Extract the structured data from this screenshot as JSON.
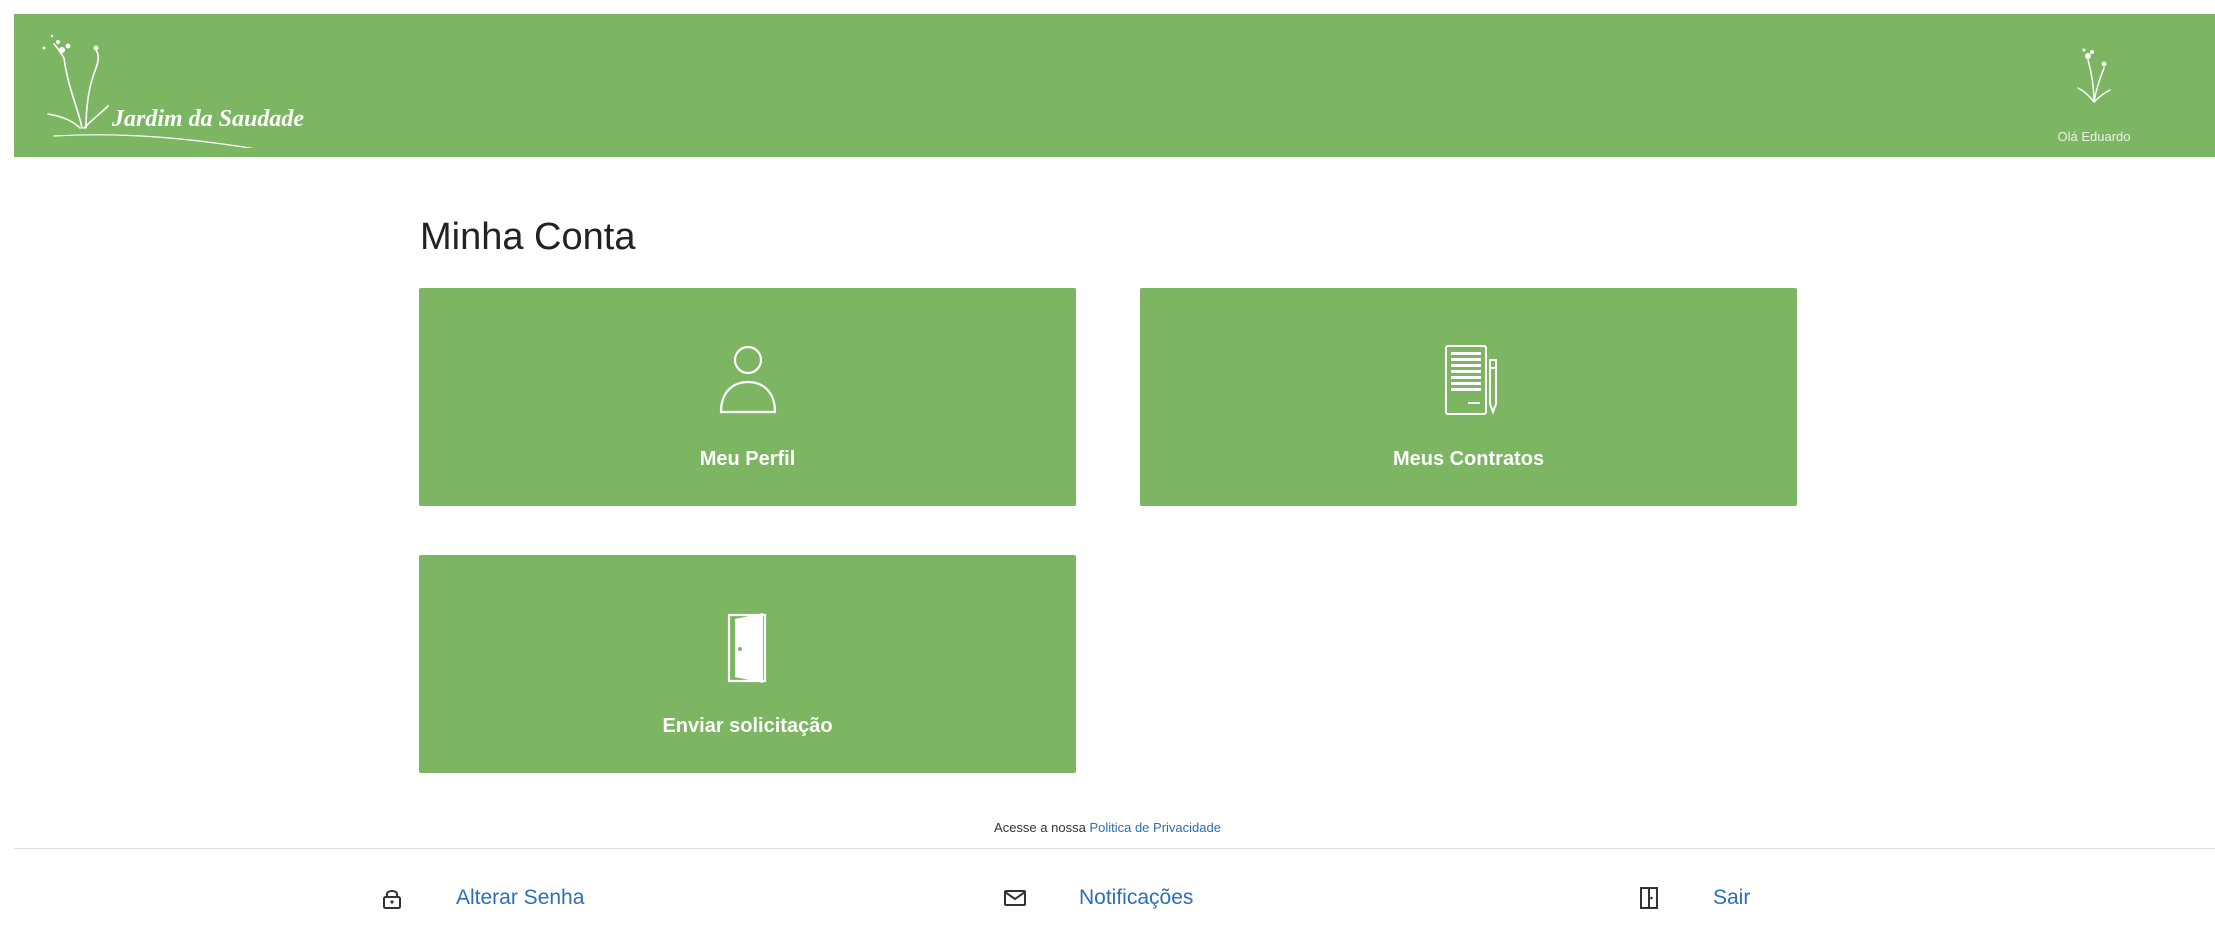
{
  "header": {
    "logo_text": "Jardim da Saudade",
    "user_greeting": "Olá Eduardo",
    "background": "#7cb663"
  },
  "main": {
    "title": "Minha Conta",
    "cards": [
      {
        "label": "Meu Perfil",
        "icon": "user-icon"
      },
      {
        "label": "Meus Contratos",
        "icon": "contract-document-icon"
      },
      {
        "label": "Enviar solicitação",
        "icon": "door-icon"
      }
    ]
  },
  "privacy": {
    "prefix": "Acesse a nossa",
    "link": "Politica de Privacidade"
  },
  "footer": {
    "items": [
      {
        "label": "Alterar Senha",
        "icon": "lock-icon"
      },
      {
        "label": "Notificações",
        "icon": "envelope-icon"
      },
      {
        "label": "Sair",
        "icon": "exit-door-icon"
      }
    ]
  },
  "colors": {
    "brand_green": "#7cb663",
    "link_blue": "#2a6fb8",
    "title_text": "#222222"
  }
}
